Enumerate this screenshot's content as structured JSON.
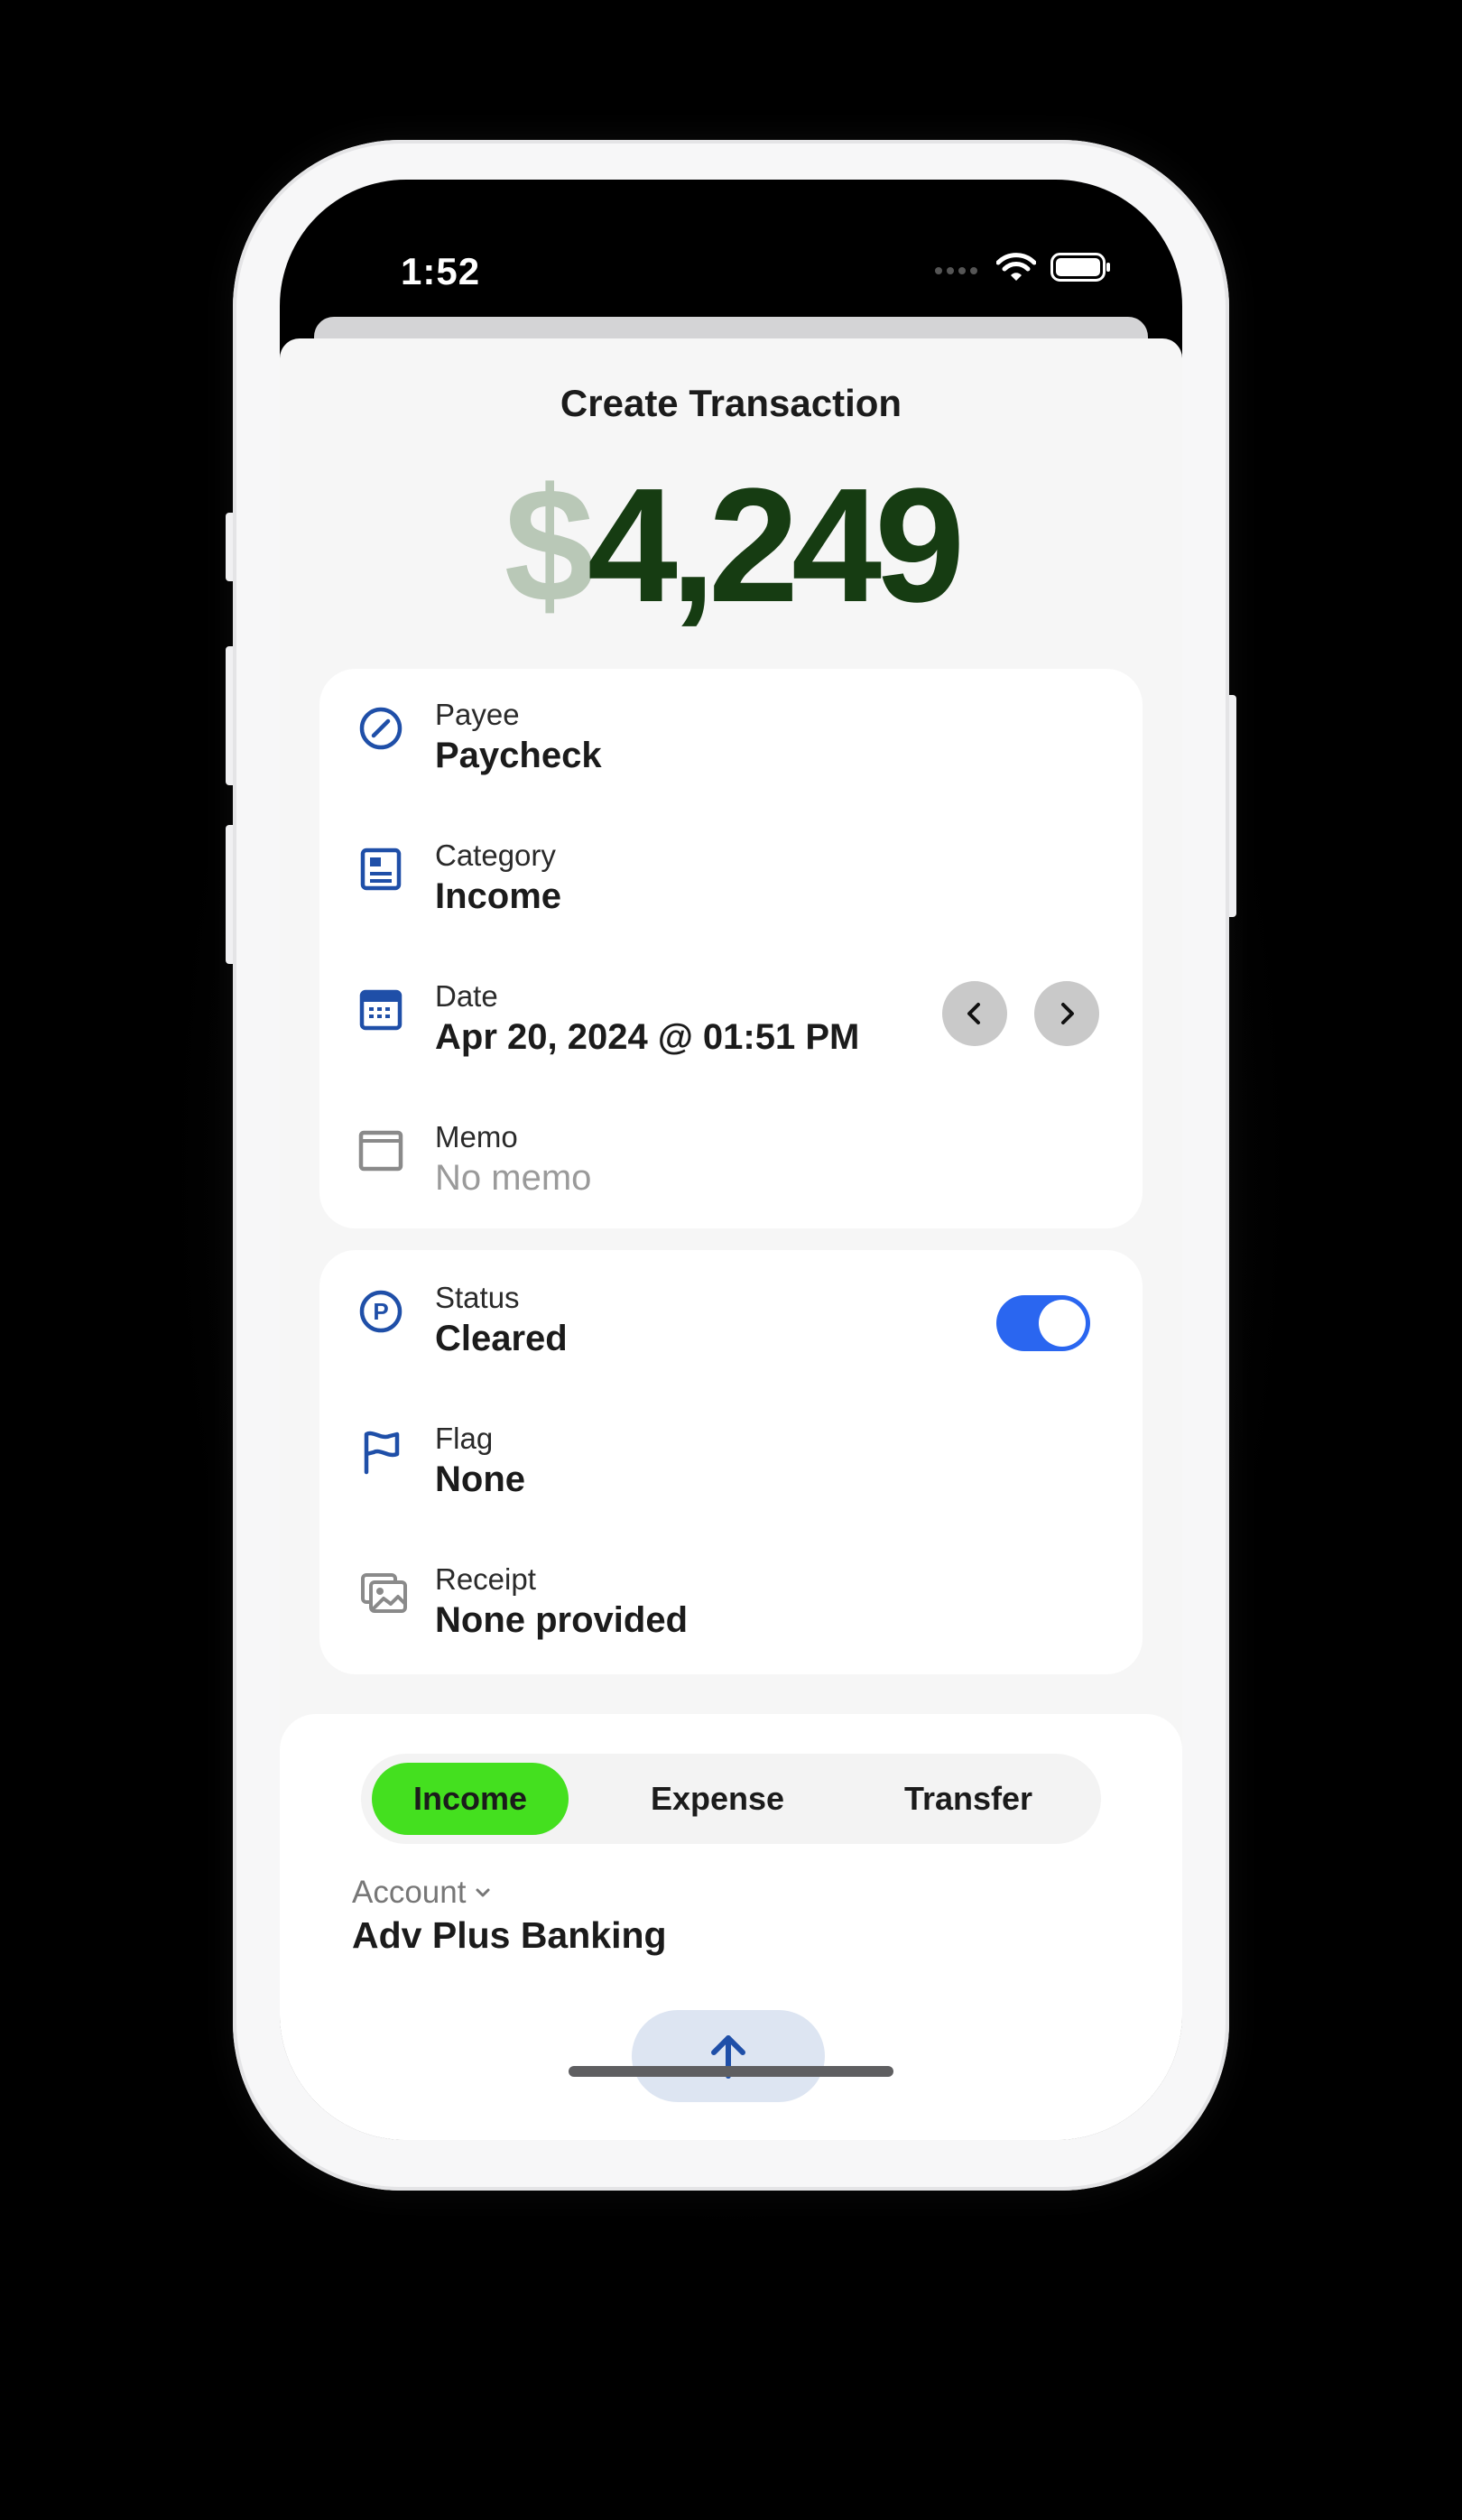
{
  "status_bar": {
    "time": "1:52"
  },
  "sheet": {
    "title": "Create Transaction"
  },
  "amount": {
    "currency": "$",
    "value": "4,249"
  },
  "details": {
    "payee": {
      "label": "Payee",
      "value": "Paycheck"
    },
    "category": {
      "label": "Category",
      "value": "Income"
    },
    "date": {
      "label": "Date",
      "value": "Apr 20, 2024 @ 01:51 PM"
    },
    "memo": {
      "label": "Memo",
      "value": "No memo"
    }
  },
  "extras": {
    "status": {
      "label": "Status",
      "value": "Cleared",
      "toggle_on": true
    },
    "flag": {
      "label": "Flag",
      "value": "None"
    },
    "receipt": {
      "label": "Receipt",
      "value": "None provided"
    }
  },
  "type_selector": {
    "options": [
      "Income",
      "Expense",
      "Transfer"
    ],
    "selected": "Income"
  },
  "account": {
    "label": "Account",
    "value": "Adv Plus Banking"
  },
  "colors": {
    "accent_blue": "#1f4fa8",
    "toggle_blue": "#2a66f0",
    "income_green": "#44e01f",
    "amount_green": "#163c12",
    "currency_green": "#b9c8b7"
  }
}
